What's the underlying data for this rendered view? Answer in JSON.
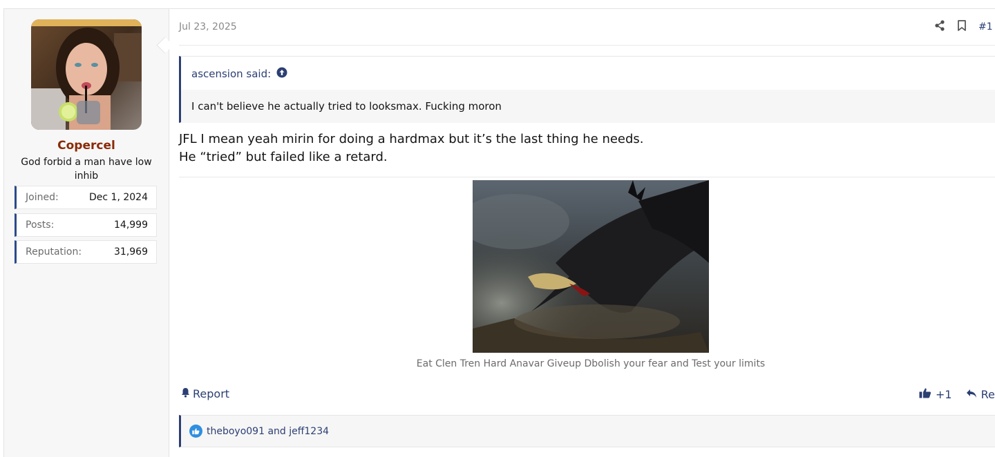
{
  "user": {
    "name": "Copercel",
    "title": "God forbid a man have low inhib",
    "stats": [
      {
        "label": "Joined:",
        "value": "Dec 1, 2024"
      },
      {
        "label": "Posts:",
        "value": "14,999"
      },
      {
        "label": "Reputation:",
        "value": "31,969"
      }
    ]
  },
  "post": {
    "date": "Jul 23, 2025",
    "number": "#1",
    "quote": {
      "author_label": "ascension said:",
      "text": "I can't believe he actually tried to looksmax. Fucking moron"
    },
    "message": [
      "JFL I mean yeah mirin for doing a hardmax but it’s the last thing he needs.",
      "He “tried” but failed like a retard."
    ],
    "image_caption": "Eat Clen Tren Hard Anavar Giveup Dbolish your fear and Test your limits",
    "report_label": "Report",
    "reaction_count": "+1",
    "reply_label": "Rep",
    "reactions_text": "theboyo091 and jeff1234"
  },
  "colors": {
    "accent": "#2b3f73",
    "username": "#8a2a06",
    "like": "#2f8fe0"
  },
  "icons": [
    "share-icon",
    "bookmark-icon",
    "arrow-up-circle-icon",
    "bell-icon",
    "thumbs-up-icon",
    "reply-icon",
    "like-reaction-icon"
  ]
}
